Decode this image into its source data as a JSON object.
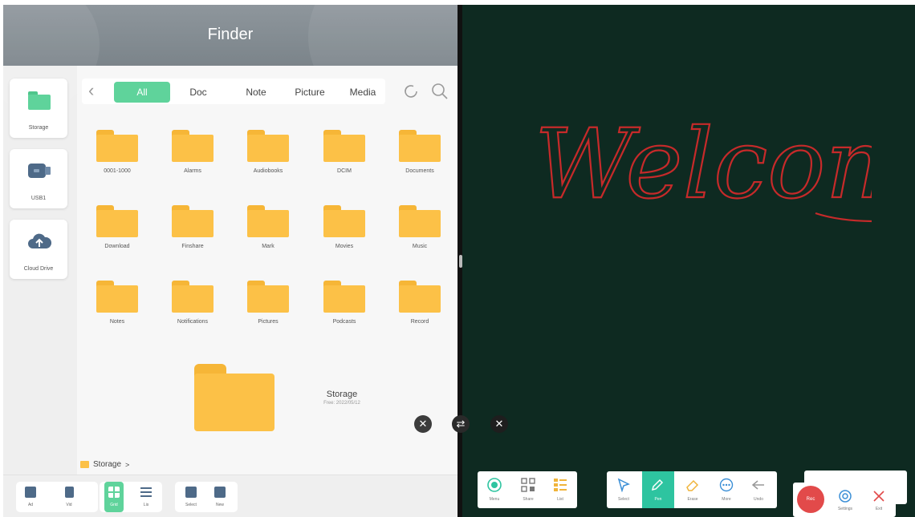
{
  "finder": {
    "title": "Finder",
    "sidebar": [
      {
        "label": "Storage",
        "icon": "storage-icon"
      },
      {
        "label": "USB1",
        "icon": "usb-icon"
      },
      {
        "label": "Cloud Drive",
        "icon": "cloud-upload-icon"
      }
    ],
    "tabs": [
      {
        "label": "All",
        "active": true
      },
      {
        "label": "Doc"
      },
      {
        "label": "Note"
      },
      {
        "label": "Picture"
      },
      {
        "label": "Media"
      }
    ],
    "folders": [
      "0001-1000",
      "Alarms",
      "Audiobooks",
      "DCIM",
      "Documents",
      "Download",
      "Finshare",
      "Mark",
      "Movies",
      "Music",
      "Notes",
      "Notifications",
      "Pictures",
      "Podcasts",
      "Record"
    ],
    "storage": {
      "name": "Storage",
      "date": "Free: 2022/05/12"
    },
    "breadcrumb": {
      "path": "Storage",
      "arrow": ">"
    },
    "bottom_toolbar": [
      "Ad",
      "Vid",
      "Grid",
      "Lis",
      "Select",
      "New"
    ],
    "colors": {
      "accent": "#5fd39b",
      "folder": "#fcc147",
      "header": "#7f888e"
    }
  },
  "overlay": {
    "close_left": "✕",
    "swap": "⇄",
    "close_right": "✕"
  },
  "board": {
    "handwriting": "Welcome",
    "ink_color": "#c62a2a",
    "background": "#0e2a21",
    "toolbar_group1": [
      {
        "label": "Menu",
        "icon": "menu-circle-icon"
      },
      {
        "label": "Share",
        "icon": "qr-share-icon"
      },
      {
        "label": "List",
        "icon": "list-icon"
      }
    ],
    "toolbar_group2": [
      {
        "label": "Select",
        "icon": "select-arrow-icon"
      },
      {
        "label": "Pen",
        "icon": "pen-icon",
        "active": true
      },
      {
        "label": "Erase",
        "icon": "eraser-icon"
      },
      {
        "label": "More",
        "icon": "more-icon"
      },
      {
        "label": "Undo",
        "icon": "undo-icon"
      }
    ],
    "rec_label": "Rec",
    "settings_label": "Settings",
    "exit_label": "Exit"
  }
}
